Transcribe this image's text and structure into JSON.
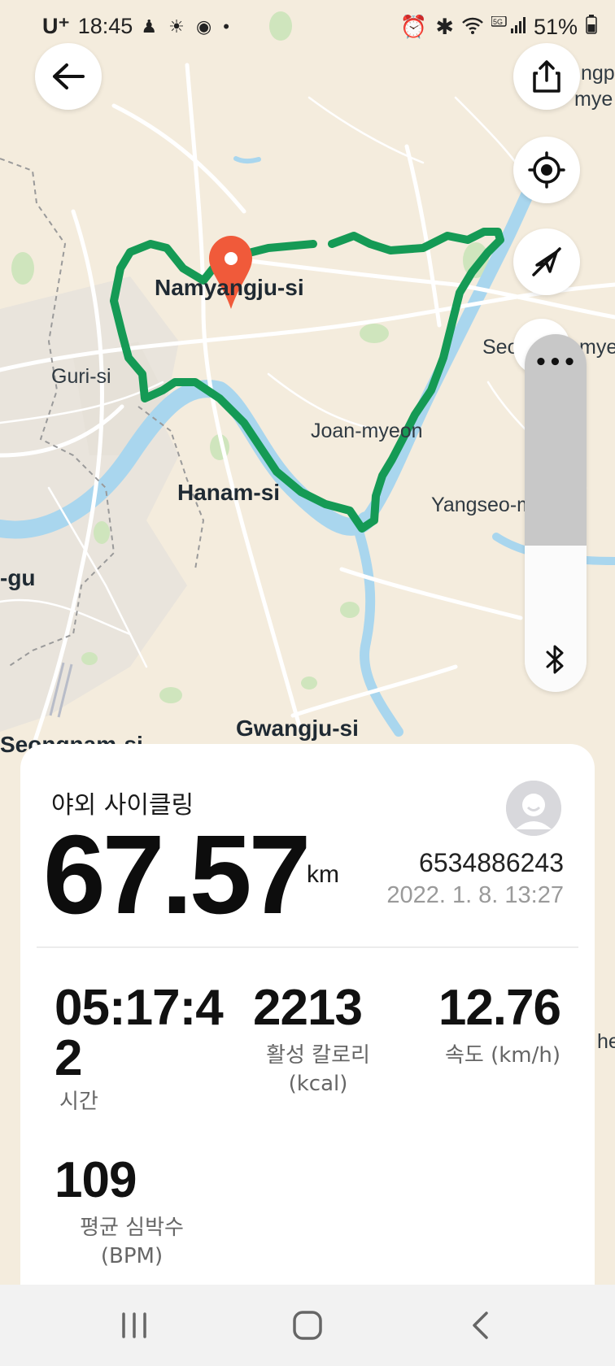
{
  "status_bar": {
    "carrier": "U⁺",
    "time": "18:45",
    "battery": "51%"
  },
  "map": {
    "labels": [
      {
        "key": "namyangju",
        "text": "Namyangju-si"
      },
      {
        "key": "guri",
        "text": "Guri-si"
      },
      {
        "key": "joan",
        "text": "Joan-myeon"
      },
      {
        "key": "hanam",
        "text": "Hanam-si"
      },
      {
        "key": "yangseo",
        "text": "Yangseo-myeon"
      },
      {
        "key": "gu",
        "text": "-gu"
      },
      {
        "key": "gwangju",
        "text": "Gwangju-si"
      },
      {
        "key": "seongnam",
        "text": "Seongnam-si"
      },
      {
        "key": "seo",
        "text": "Seo"
      },
      {
        "key": "mye",
        "text": "mye"
      },
      {
        "key": "ngp",
        "text": "ngp"
      },
      {
        "key": "mye2",
        "text": "mye"
      },
      {
        "key": "he",
        "text": "he"
      }
    ],
    "route_color": "#159a55",
    "pin_color": "#f05a3a"
  },
  "controls": {
    "back": "back-arrow-icon",
    "share": "share-icon",
    "locate": "locate-icon",
    "location_off": "location-off-icon",
    "more": "•••",
    "bluetooth": "bluetooth-icon"
  },
  "activity": {
    "name": "야외 사이클링",
    "distance": "67.57",
    "distance_unit": "km",
    "user_id": "6534886243",
    "datetime": "2022. 1. 8. 13:27"
  },
  "stats": {
    "time": {
      "value_line1": "05:17:4",
      "value_line2": "2",
      "label": "시간"
    },
    "calories": {
      "value": "2213",
      "label_line1": "활성 칼로리",
      "label_line2": "(kcal)"
    },
    "speed": {
      "value": "12.76",
      "label": "속도 (km/h)"
    },
    "heart_rate": {
      "value": "109",
      "label_line1": "평균 심박수",
      "label_line2": "(BPM)"
    }
  }
}
